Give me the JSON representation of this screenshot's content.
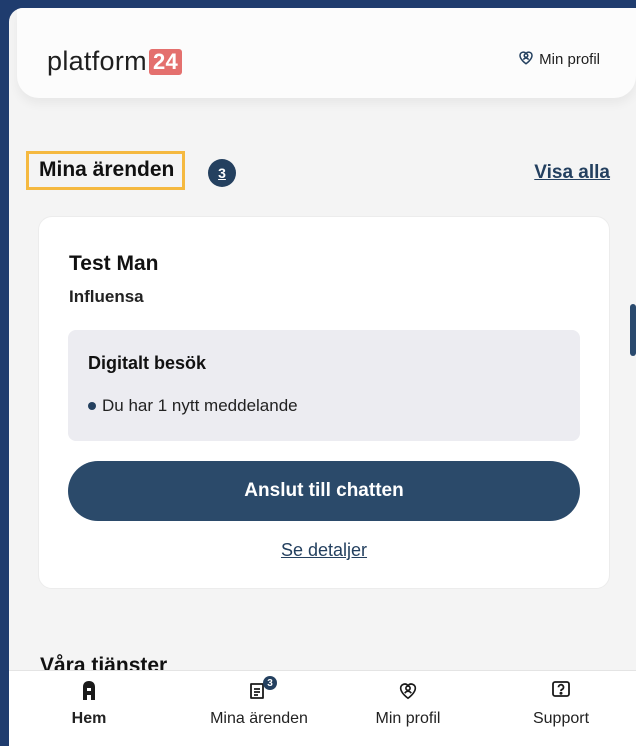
{
  "header": {
    "logo_text": "platform",
    "logo_badge": "24",
    "profile_label": "Min profil"
  },
  "cases": {
    "title": "Mina ärenden",
    "count": "3",
    "show_all": "Visa alla",
    "card": {
      "patient_name": "Test Man",
      "diagnosis": "Influensa",
      "visit_type": "Digitalt besök",
      "message": "Du har 1 nytt meddelande",
      "chat_button": "Anslut till chatten",
      "details_link": "Se detaljer"
    }
  },
  "services": {
    "title": "Våra tjänster"
  },
  "bottom_nav": {
    "items": [
      {
        "label": "Hem",
        "icon": "home-icon",
        "active": true
      },
      {
        "label": "Mina ärenden",
        "icon": "cases-icon",
        "badge": "3"
      },
      {
        "label": "Min profil",
        "icon": "profile-icon"
      },
      {
        "label": "Support",
        "icon": "support-icon"
      }
    ]
  },
  "colors": {
    "primary": "#2b4a6a",
    "logo_badge": "#e4706e",
    "highlight_border": "#f5b940",
    "frame": "#1f3c6e"
  }
}
